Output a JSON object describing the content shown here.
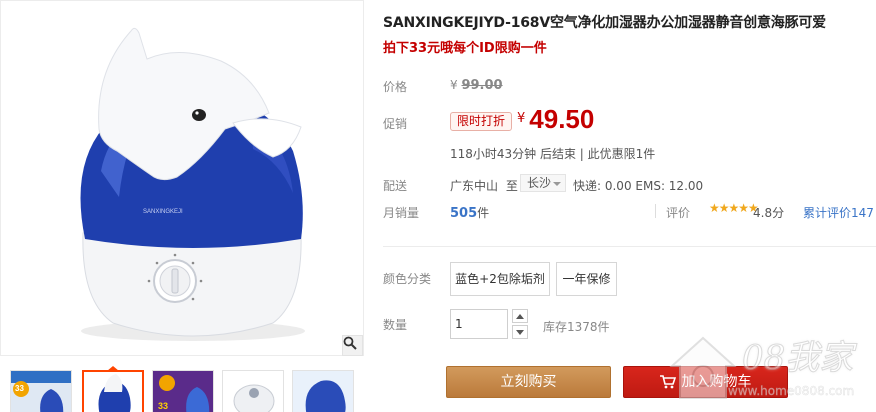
{
  "product": {
    "title": "SANXINGKEJIYD-168V空气净化加湿器办公加湿器静音创意海豚可爱",
    "subtitle": "拍下33元哦每个ID限购一件"
  },
  "labels": {
    "price": "价格",
    "promo": "促销",
    "shipping": "配送",
    "monthly_sales": "月销量",
    "rating": "评价",
    "color": "颜色分类",
    "quantity": "数量"
  },
  "price": {
    "currency": "¥",
    "original": "99.00",
    "promo_tag": "限时打折",
    "current": "49.50",
    "countdown": "118小时43分钟 后结束 | 此优惠限1件"
  },
  "shipping": {
    "from": "广东中山",
    "to_word": "至",
    "to_city": "长沙",
    "fee": "快递: 0.00 EMS: 12.00"
  },
  "sales": {
    "count": "505",
    "unit": "件",
    "stars": "★★★★★",
    "rating": "4.8分",
    "review_link": "累计评价147"
  },
  "sku": {
    "options": [
      "蓝色+2包除垢剂",
      "一年保修"
    ]
  },
  "quantity": {
    "value": "1",
    "stock": "库存1378件"
  },
  "actions": {
    "buy_now": "立刻购买",
    "add_to_cart": "加入购物车"
  },
  "watermark": {
    "brand": "08我家",
    "url": "www.home0808.com"
  },
  "thumbnails": {
    "badges": [
      "33",
      "33"
    ]
  },
  "product_image": {
    "label_on_body": "SANXINGKEJI"
  },
  "colors": {
    "accent_red": "#c40000",
    "buy_button": "#c88a4a",
    "cart_button": "#c8201a",
    "link_blue": "#3a74c7",
    "star": "#f0a81e",
    "humidifier_blue": "#1f3fae"
  },
  "icons": {
    "zoom": "magnifier-icon",
    "cart": "cart-icon",
    "qty_up": "chevron-up-icon",
    "qty_down": "chevron-down-icon",
    "ship_dropdown": "caret-down-icon"
  }
}
